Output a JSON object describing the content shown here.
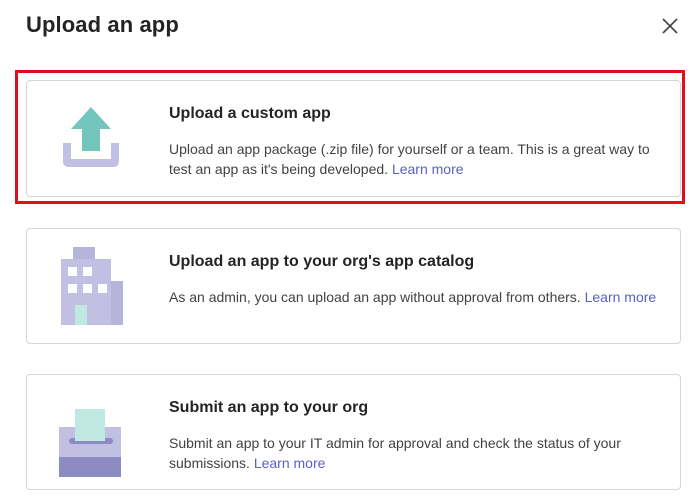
{
  "dialog": {
    "title": "Upload an app",
    "close_icon": "close-icon"
  },
  "colors": {
    "highlight": "#e0101a",
    "link": "#5b5fc7",
    "icon_lavender": "#c1bfe2",
    "icon_teal": "#73c6bb",
    "icon_dark_purple": "#8c8cc2"
  },
  "options": [
    {
      "icon": "upload-icon",
      "title": "Upload a custom app",
      "description": "Upload an app package (.zip file) for yourself or a team. This is a great way to test an app as it's being developed.",
      "link": "Learn more"
    },
    {
      "icon": "building-icon",
      "title": "Upload an app to your org's app catalog",
      "description": "As an admin, you can upload an app without approval from others.",
      "link": "Learn more"
    },
    {
      "icon": "submit-box-icon",
      "title": "Submit an app to your org",
      "description": "Submit an app to your IT admin for approval and check the status of your submissions.",
      "link": "Learn more"
    }
  ]
}
